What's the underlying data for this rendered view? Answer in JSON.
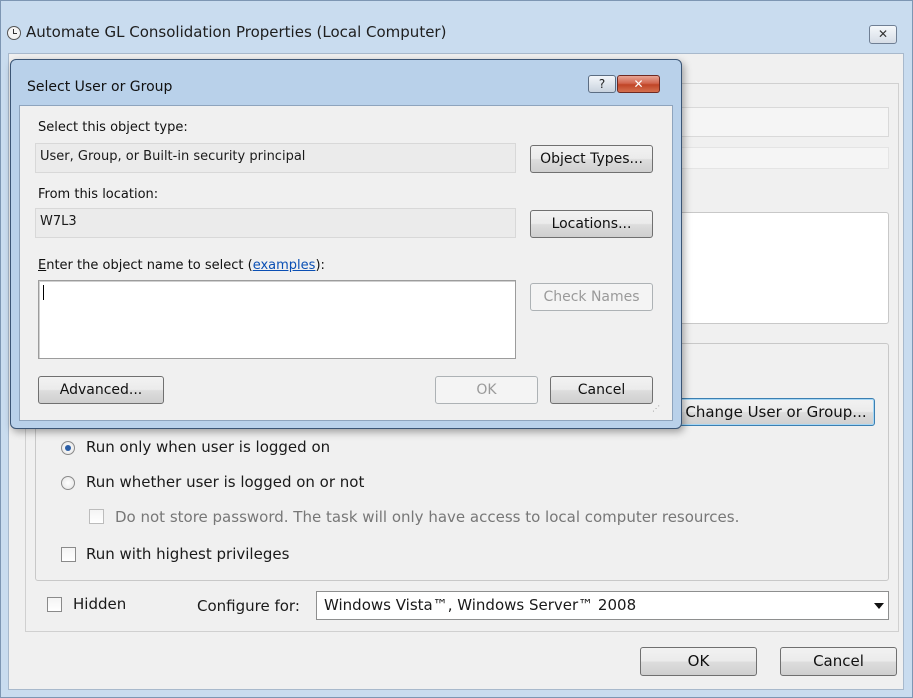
{
  "window": {
    "title": "Automate GL Consolidation Properties (Local Computer)",
    "close_glyph": "✕"
  },
  "security": {
    "change_user_button": "Change User or Group...",
    "run_logged_on": "Run only when user is logged on",
    "run_whether": "Run whether user is logged on or not",
    "no_store_password": "Do not store password.  The task will only have access to local computer resources.",
    "highest_privileges": "Run with highest privileges",
    "hidden": "Hidden",
    "configure_for_label": "Configure for:",
    "configure_for_value": "Windows Vista™, Windows Server™ 2008"
  },
  "buttons": {
    "ok": "OK",
    "cancel": "Cancel"
  },
  "dialog": {
    "title": "Select User or Group",
    "help_glyph": "?",
    "close_glyph": "✕",
    "object_type_label": "Select this object type:",
    "object_type_value": "User, Group, or Built-in security principal",
    "object_types_button": "Object Types...",
    "location_label": "From this location:",
    "location_value": "W7L3",
    "locations_button": "Locations...",
    "enter_name_prefix": "nter the object name to select (",
    "enter_name_e": "E",
    "examples_link": "examples",
    "enter_name_suffix": "):",
    "object_name_value": "",
    "check_names_button": "Check Names",
    "advanced_button": "Advanced...",
    "ok_button": "OK",
    "cancel_button": "Cancel"
  },
  "colors": {
    "titlebar": "#c9dcef",
    "dialog_frame": "#b9d1ea",
    "close_red": "#c04527",
    "link_blue": "#0a4fb4"
  }
}
